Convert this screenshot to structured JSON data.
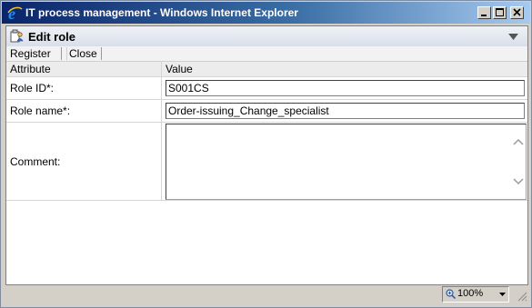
{
  "window": {
    "title": "IT process management - Windows Internet Explorer"
  },
  "dialog": {
    "title": "Edit role"
  },
  "toolbar": {
    "register_label": "Register",
    "close_label": "Close"
  },
  "table": {
    "header_attribute": "Attribute",
    "header_value": "Value",
    "rows": [
      {
        "label": "Role ID*:",
        "value": "S001CS"
      },
      {
        "label": "Role name*:",
        "value": "Order-issuing_Change_specialist"
      },
      {
        "label": "Comment:",
        "value": ""
      }
    ]
  },
  "statusbar": {
    "zoom": "100%"
  },
  "icons": {
    "app": "ie-icon",
    "edit": "edit-role-icon",
    "collapse": "chevron-down-icon",
    "zoom": "zoom-icon"
  },
  "colors": {
    "titlebar_start": "#0a246a",
    "titlebar_end": "#a6caf0",
    "ie_blue": "#1c5fc4",
    "chrome": "#d4d0c8"
  }
}
